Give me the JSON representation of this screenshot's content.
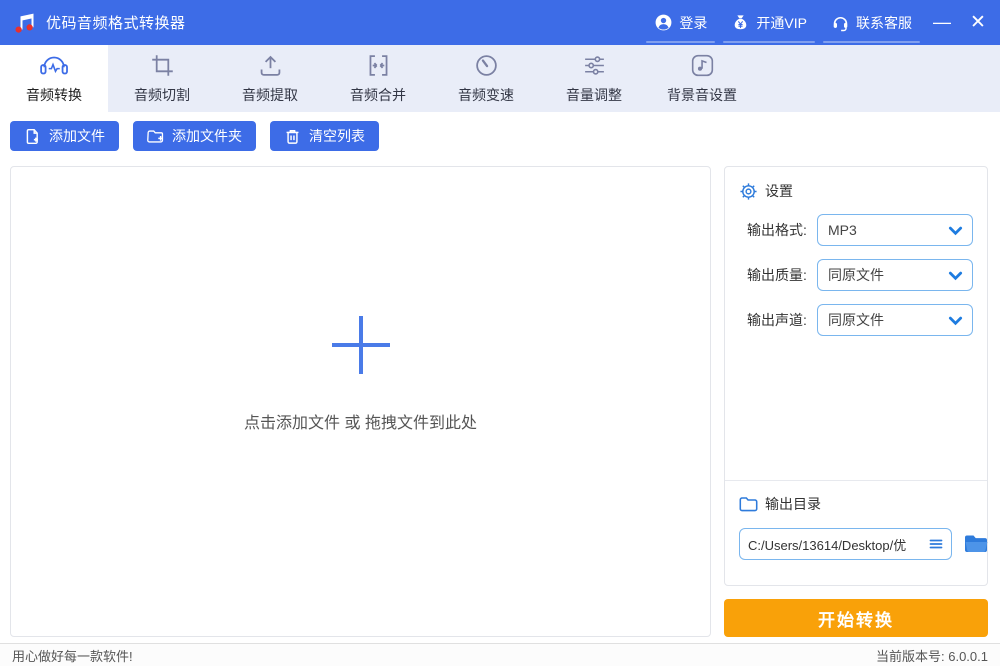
{
  "colors": {
    "titlebar": "#3D6CE7",
    "accent": "#3D6CE7",
    "toolbar_bg": "#E9EDF8",
    "tab_icon_gray": "#7B81A3",
    "dropdown_border": "#7AB6EE",
    "chevron_blue": "#1E7CE0",
    "convert_orange": "#F9A109",
    "logo_red": "#E8302E"
  },
  "window": {
    "title": "优码音频格式转换器",
    "menu": [
      {
        "label": "登录"
      },
      {
        "label": "开通VIP"
      },
      {
        "label": "联系客服"
      }
    ],
    "minimize_glyph": "—",
    "close_glyph": "✕"
  },
  "tabs": [
    {
      "label": "音频转换",
      "icon": "headphones-wave",
      "active": true
    },
    {
      "label": "音频切割",
      "icon": "crop"
    },
    {
      "label": "音频提取",
      "icon": "upload"
    },
    {
      "label": "音频合并",
      "icon": "merge-brackets"
    },
    {
      "label": "音频变速",
      "icon": "speedometer"
    },
    {
      "label": "音量调整",
      "icon": "sliders"
    },
    {
      "label": "背景音设置",
      "icon": "music-note-square"
    }
  ],
  "actions": [
    {
      "label": "添加文件",
      "icon": "file-plus"
    },
    {
      "label": "添加文件夹",
      "icon": "folder-plus"
    },
    {
      "label": "清空列表",
      "icon": "trash"
    }
  ],
  "dropzone": {
    "hint": "点击添加文件 或 拖拽文件到此处"
  },
  "settings": {
    "header": "设置",
    "rows": [
      {
        "label": "输出格式:",
        "value": "MP3"
      },
      {
        "label": "输出质量:",
        "value": "同原文件"
      },
      {
        "label": "输出声道:",
        "value": "同原文件"
      }
    ]
  },
  "output": {
    "header": "输出目录",
    "path": "C:/Users/13614/Desktop/优"
  },
  "convert": {
    "label": "开始转换"
  },
  "statusbar": {
    "left": "用心做好每一款软件!",
    "version": "当前版本号:  6.0.0.1"
  }
}
